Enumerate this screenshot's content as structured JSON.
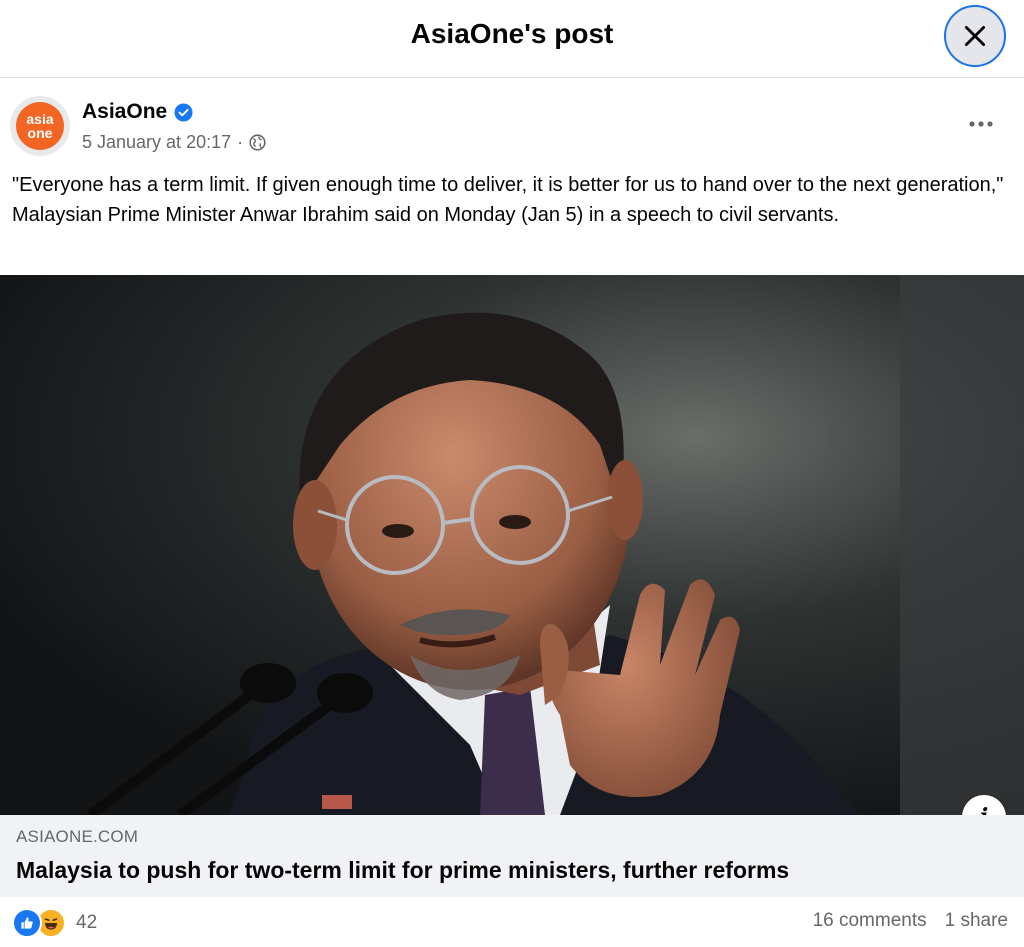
{
  "header": {
    "title": "AsiaOne's post"
  },
  "post": {
    "author": "AsiaOne",
    "avatar_text_top": "asia",
    "avatar_text_bottom": "one",
    "date": "5 January at 20:17",
    "meta_separator": "·",
    "text": "\"Everyone has a term limit. If given enough time to deliver, it is better for us to hand over to the next generation,\" Malaysian Prime Minister Anwar Ibrahim said on Monday (Jan 5) in a speech to civil servants."
  },
  "link": {
    "domain": "ASIAONE.COM",
    "title": "Malaysia to push for two-term limit for prime ministers, further reforms",
    "info_label": "i"
  },
  "stats": {
    "reaction_count": "42",
    "comments": "16 comments",
    "shares": "1 share"
  },
  "colors": {
    "accent": "#1877f2",
    "brand_orange": "#f26522",
    "secondary_text": "#65676b"
  }
}
